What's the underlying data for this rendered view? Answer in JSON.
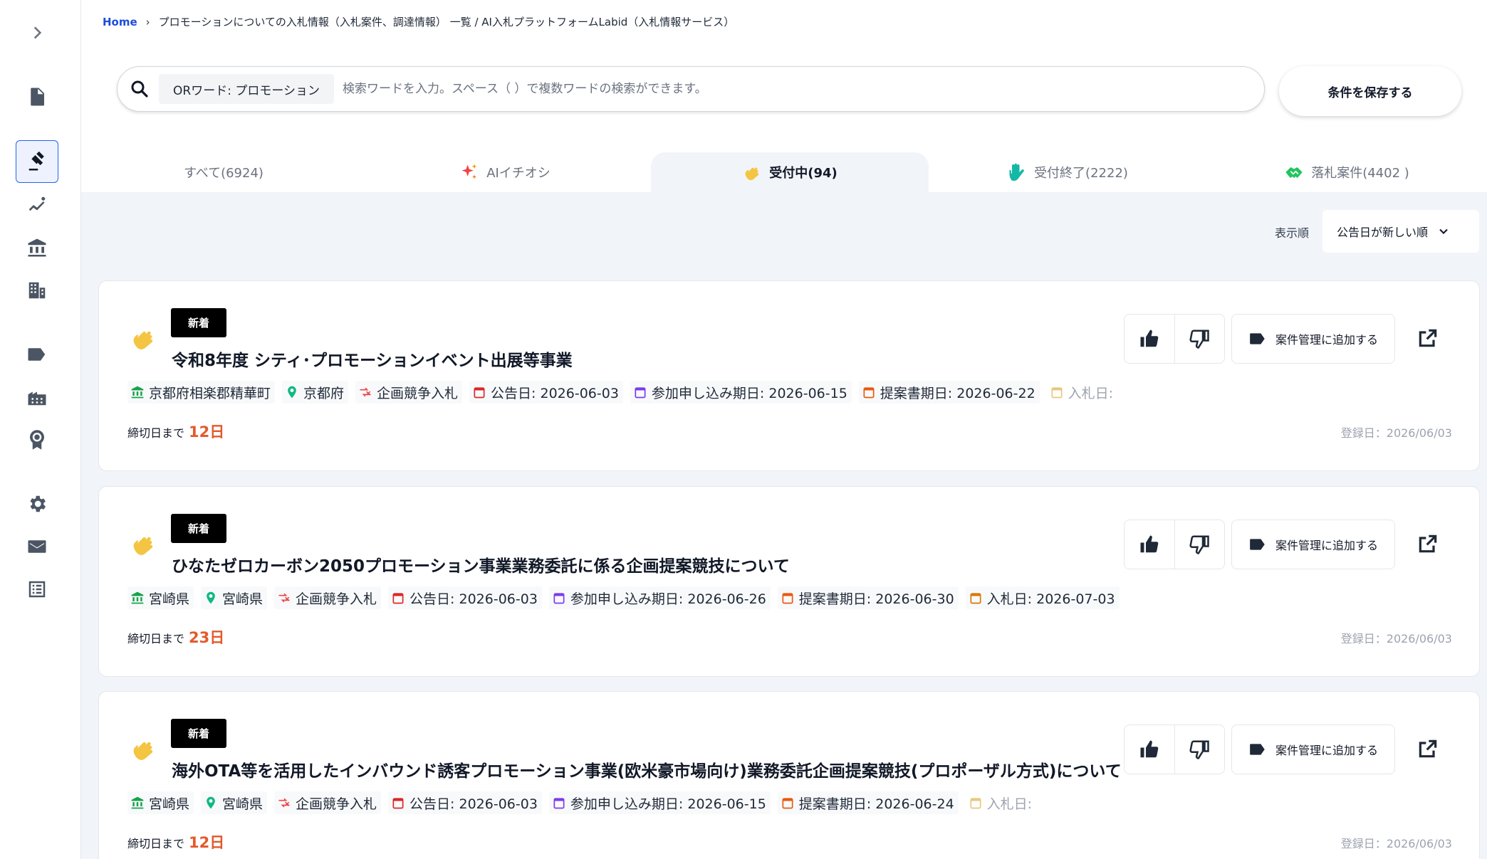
{
  "breadcrumb": {
    "home": "Home",
    "current": "プロモーションについての入札情報（入札案件、調達情報） 一覧 / AI入札プラットフォームLabid（入札情報サービス）"
  },
  "search": {
    "or_chip": "ORワード: プロモーション",
    "placeholder": "検索ワードを入力。スペース（ ）で複数ワードの検索ができます。",
    "value": ""
  },
  "save_button": "条件を保存する",
  "tabs": [
    {
      "label": "すべて(6924)"
    },
    {
      "label": "AIイチオシ"
    },
    {
      "label": "受付中(94)"
    },
    {
      "label": "受付終了(2222)"
    },
    {
      "label": "落札案件(4402 )"
    }
  ],
  "sort": {
    "label": "表示順",
    "selected": "公告日が新しい順"
  },
  "card_common": {
    "vote_up": "thumb-up",
    "vote_down": "thumb-down",
    "add_label": "案件管理に追加する",
    "deadline_prefix": "締切日まで"
  },
  "cards": [
    {
      "badge": "新着",
      "title": "令和8年度 シティ･プロモーションイベント出展等事業",
      "org": "京都府相楽郡精華町",
      "pref": "京都府",
      "type": "企画競争入札",
      "published": "公告日: 2026-06-03",
      "apply": "参加申し込み期日: 2026-06-15",
      "proposal": "提案書期日: 2026-06-22",
      "bid": "入札日:",
      "days": "12日",
      "registered": "登録日：2026/06/03"
    },
    {
      "badge": "新着",
      "title": "ひなたゼロカーボン2050プロモーション事業業務委託に係る企画提案競技について",
      "org": "宮崎県",
      "pref": "宮崎県",
      "type": "企画競争入札",
      "published": "公告日: 2026-06-03",
      "apply": "参加申し込み期日: 2026-06-26",
      "proposal": "提案書期日: 2026-06-30",
      "bid": "入札日: 2026-07-03",
      "days": "23日",
      "registered": "登録日：2026/06/03"
    },
    {
      "badge": "新着",
      "title": "海外OTA等を活用したインバウンド誘客プロモーション事業(欧米豪市場向け)業務委託企画提案競技(プロポーザル方式)について",
      "org": "宮崎県",
      "pref": "宮崎県",
      "type": "企画競争入札",
      "published": "公告日: 2026-06-03",
      "apply": "参加申し込み期日: 2026-06-15",
      "proposal": "提案書期日: 2026-06-24",
      "bid": "入札日:",
      "days": "12日",
      "registered": "登録日：2026/06/03"
    }
  ],
  "colors": {
    "accent": "#1d4ed8",
    "deadline": "#e25a2c",
    "org_icon": "#16a34a",
    "pin_icon": "#10b981",
    "type_icon": "#ef4444",
    "published_icon": "#dc2626",
    "apply_icon": "#7c3aed",
    "proposal_icon": "#ea580c",
    "bid_icon": "#d97706"
  }
}
